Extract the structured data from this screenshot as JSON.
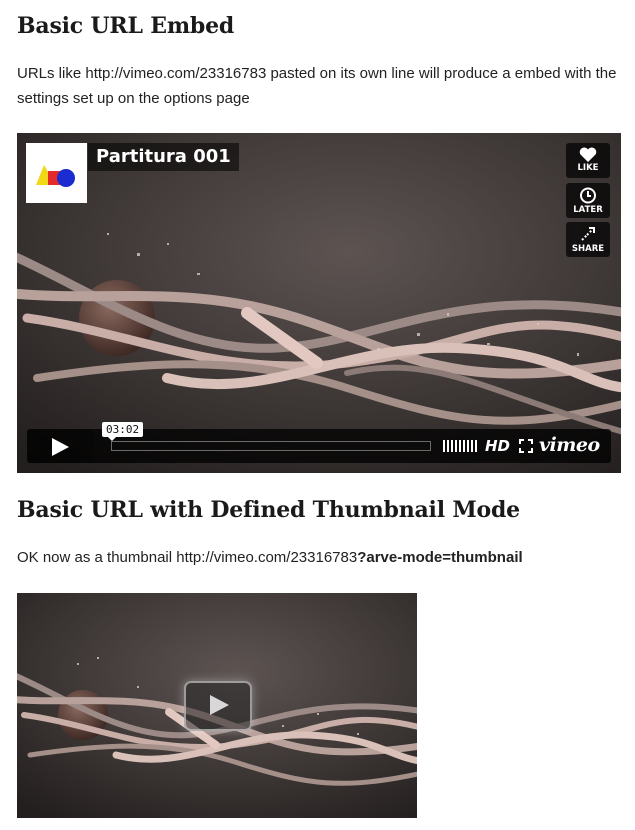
{
  "section1": {
    "heading": "Basic URL Embed",
    "paragraph": "URLs like http://vimeo.com/23316783 pasted on its own line will produce a embed with the settings set up on the options page"
  },
  "player": {
    "title": "Partitura 001",
    "like_label": "LIKE",
    "later_label": "LATER",
    "share_label": "SHARE",
    "time": "03:02",
    "hd_label": "HD",
    "brand": "vimeo",
    "progress": 0
  },
  "section2": {
    "heading": "Basic URL with Defined Thumbnail Mode",
    "paragraph_plain": "OK now as a thumbnail http://vimeo.com/23316783",
    "paragraph_bold": "?arve-mode=thumbnail"
  },
  "icons": {
    "like": "heart-icon",
    "later": "clock-icon",
    "share": "share-icon",
    "play": "play-icon",
    "volume": "volume-bars-icon",
    "fullscreen": "fullscreen-icon"
  },
  "colors": {
    "page_bg": "#ffffff",
    "text": "#222222",
    "player_bg": "#2e2a29",
    "control_bg": "#000000"
  }
}
